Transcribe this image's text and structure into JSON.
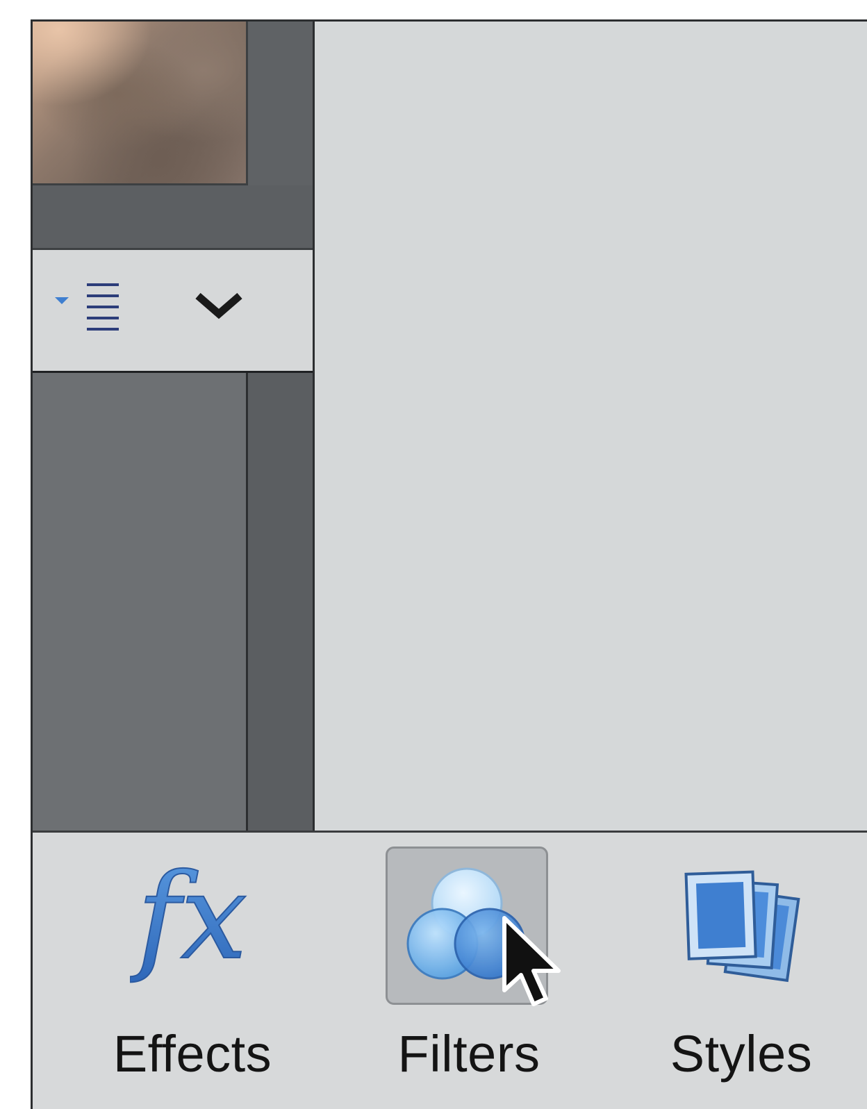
{
  "bottom_bar": {
    "items": [
      {
        "label": "Effects",
        "icon": "fx-icon",
        "selected": false
      },
      {
        "label": "Filters",
        "icon": "filters-circles-icon",
        "selected": true
      },
      {
        "label": "Styles",
        "icon": "styles-stack-icon",
        "selected": false
      }
    ]
  },
  "left_panel": {
    "toolbar_icons": [
      "list-view-icon",
      "chevron-down-icon"
    ]
  },
  "colors": {
    "accent_blue": "#3f7fd0",
    "panel_dark": "#5f6265",
    "panel_light": "#d5d8d9"
  }
}
